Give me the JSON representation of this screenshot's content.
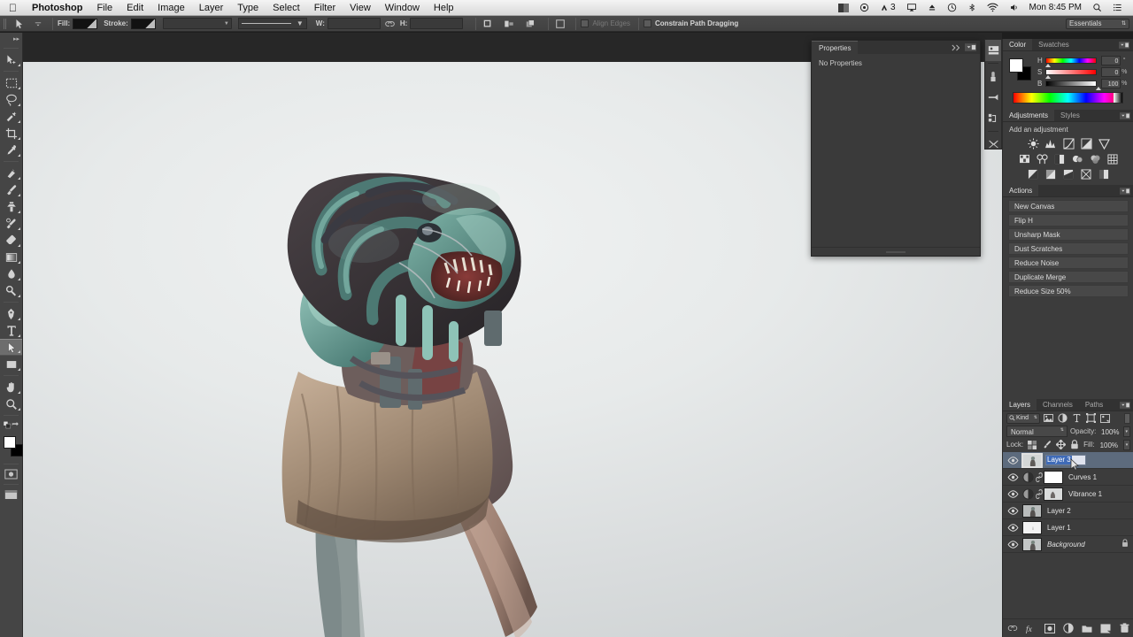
{
  "macos_menubar": {
    "apple_icon": "apple-logo",
    "app_name": "Photoshop",
    "menus": [
      "File",
      "Edit",
      "Image",
      "Layer",
      "Type",
      "Select",
      "Filter",
      "View",
      "Window",
      "Help"
    ],
    "status_items": [
      {
        "name": "display-swatch-icon",
        "label": ""
      },
      {
        "name": "dropbox-icon",
        "label": ""
      },
      {
        "name": "adobe-cc-icon",
        "label": "3"
      },
      {
        "name": "airplay-icon",
        "label": ""
      },
      {
        "name": "eject-icon",
        "label": ""
      },
      {
        "name": "time-machine-icon",
        "label": ""
      },
      {
        "name": "bluetooth-icon",
        "label": ""
      },
      {
        "name": "wifi-icon",
        "label": ""
      },
      {
        "name": "volume-icon",
        "label": ""
      }
    ],
    "clock": "Mon 8:45 PM",
    "spotlight_icon": "search-icon",
    "notification_icon": "list-icon"
  },
  "options_bar": {
    "tool_icon": "path-selection-tool-icon",
    "fill_label": "Fill:",
    "stroke_label": "Stroke:",
    "stroke_width_value": "",
    "stroke_style_value": "",
    "width_label": "W:",
    "width_value": "",
    "link_icon": "link-dimensions-icon",
    "height_label": "H:",
    "height_value": "",
    "path_ops": [
      "path-operations-icon",
      "path-alignment-icon",
      "path-arrangement-icon",
      "path-options-icon"
    ],
    "align_edges_label": "Align Edges",
    "align_edges_checked": false,
    "align_edges_enabled": false,
    "constrain_label": "Constrain Path Dragging",
    "constrain_checked": false
  },
  "workspace": {
    "selector_value": "Essentials"
  },
  "toolbar": {
    "tools": [
      {
        "name": "move-tool",
        "label": "Move Tool",
        "active": false,
        "group": 0
      },
      {
        "name": "rectangular-marquee-tool",
        "label": "Rectangular Marquee Tool",
        "active": false,
        "group": 1
      },
      {
        "name": "lasso-tool",
        "label": "Lasso Tool",
        "active": false,
        "group": 1
      },
      {
        "name": "quick-selection-tool",
        "label": "Quick Selection Tool",
        "active": false,
        "group": 1
      },
      {
        "name": "crop-tool",
        "label": "Crop Tool",
        "active": false,
        "group": 1
      },
      {
        "name": "eyedropper-tool",
        "label": "Eyedropper Tool",
        "active": false,
        "group": 1
      },
      {
        "name": "spot-healing-brush-tool",
        "label": "Spot Healing Brush Tool",
        "active": false,
        "group": 2
      },
      {
        "name": "brush-tool",
        "label": "Brush Tool",
        "active": false,
        "group": 2
      },
      {
        "name": "clone-stamp-tool",
        "label": "Clone Stamp Tool",
        "active": false,
        "group": 2
      },
      {
        "name": "history-brush-tool",
        "label": "History Brush Tool",
        "active": false,
        "group": 2
      },
      {
        "name": "eraser-tool",
        "label": "Eraser Tool",
        "active": false,
        "group": 2
      },
      {
        "name": "gradient-tool",
        "label": "Gradient Tool",
        "active": false,
        "group": 2
      },
      {
        "name": "blur-tool",
        "label": "Blur Tool",
        "active": false,
        "group": 2
      },
      {
        "name": "dodge-tool",
        "label": "Dodge Tool",
        "active": false,
        "group": 2
      },
      {
        "name": "pen-tool",
        "label": "Pen Tool",
        "active": false,
        "group": 3
      },
      {
        "name": "type-tool",
        "label": "Horizontal Type Tool",
        "active": false,
        "group": 3
      },
      {
        "name": "path-selection-tool",
        "label": "Path Selection Tool",
        "active": true,
        "group": 3
      },
      {
        "name": "rectangle-shape-tool",
        "label": "Rectangle Tool",
        "active": false,
        "group": 3
      },
      {
        "name": "hand-tool",
        "label": "Hand Tool",
        "active": false,
        "group": 4
      },
      {
        "name": "zoom-tool",
        "label": "Zoom Tool",
        "active": false,
        "group": 4
      }
    ],
    "foreground_color": "#ffffff",
    "background_color": "#000000",
    "quick_mask_icon": "quick-mask-icon",
    "screen_mode_icon": "screen-mode-icon"
  },
  "properties_panel": {
    "tabs": [
      {
        "label": "Properties",
        "active": true
      }
    ],
    "empty_message": "No Properties"
  },
  "icon_dock": {
    "items": [
      "mini-bridge-icon",
      "brush-presets-icon",
      "brush-settings-icon",
      "clone-source-icon",
      "tool-presets-icon"
    ]
  },
  "color_panel": {
    "tabs": [
      {
        "label": "Color",
        "active": true
      },
      {
        "label": "Swatches",
        "active": false
      }
    ],
    "foreground_color": "#ffffff",
    "background_color": "#000000",
    "sliders": [
      {
        "label": "H",
        "value": "0",
        "unit": "°",
        "knob_pct": 0,
        "track": "hue"
      },
      {
        "label": "S",
        "value": "0",
        "unit": "%",
        "knob_pct": 0,
        "track": "sat"
      },
      {
        "label": "B",
        "value": "100",
        "unit": "%",
        "knob_pct": 100,
        "track": "bri"
      }
    ]
  },
  "adjustments_panel": {
    "tabs": [
      {
        "label": "Adjustments",
        "active": true
      },
      {
        "label": "Styles",
        "active": false
      }
    ],
    "heading": "Add an adjustment",
    "rows": [
      [
        "brightness-contrast-icon",
        "levels-icon",
        "curves-icon",
        "exposure-icon",
        "vibrance-icon"
      ],
      [
        "hue-saturation-icon",
        "color-balance-icon",
        "black-white-icon",
        "photo-filter-icon",
        "channel-mixer-icon",
        "color-lookup-icon"
      ],
      [
        "invert-icon",
        "posterize-icon",
        "threshold-icon",
        "gradient-map-icon",
        "selective-color-icon"
      ]
    ]
  },
  "actions_panel": {
    "tabs": [
      {
        "label": "Actions",
        "active": true
      }
    ],
    "items": [
      "New Canvas",
      "Flip H",
      "Unsharp Mask",
      "Dust Scratches",
      "Reduce Noise",
      "Duplicate Merge",
      "Reduce Size 50%"
    ]
  },
  "layers_panel": {
    "tabs": [
      {
        "label": "Layers",
        "active": true
      },
      {
        "label": "Channels",
        "active": false
      },
      {
        "label": "Paths",
        "active": false
      }
    ],
    "filter": {
      "kind_label": "Kind",
      "search_icon": "search-icon",
      "filter_icons": [
        "filter-pixel-icon",
        "filter-adjustment-icon",
        "filter-type-icon",
        "filter-shape-icon",
        "filter-smart-object-icon"
      ],
      "toggle_icon": "filter-toggle-switch"
    },
    "blend_mode": "Normal",
    "opacity_label": "Opacity:",
    "opacity_value": "100%",
    "fill_label": "Fill:",
    "fill_value": "100%",
    "lock_label": "Lock:",
    "lock_icons": [
      "lock-transparency-icon",
      "lock-image-icon",
      "lock-position-icon",
      "lock-all-icon"
    ],
    "rows": [
      {
        "name": "Layer 3",
        "type": "pixel",
        "visible": true,
        "selected": true,
        "editing": true,
        "locked": false,
        "has_mask": false
      },
      {
        "name": "Curves 1",
        "type": "adjustment-curves",
        "visible": true,
        "selected": false,
        "editing": false,
        "locked": false,
        "has_mask": true
      },
      {
        "name": "Vibrance 1",
        "type": "adjustment-vibrance",
        "visible": true,
        "selected": false,
        "editing": false,
        "locked": false,
        "has_mask": true
      },
      {
        "name": "Layer 2",
        "type": "pixel",
        "visible": true,
        "selected": false,
        "editing": false,
        "locked": false,
        "has_mask": false
      },
      {
        "name": "Layer 1",
        "type": "pixel-empty",
        "visible": true,
        "selected": false,
        "editing": false,
        "locked": false,
        "has_mask": false
      },
      {
        "name": "Background",
        "type": "pixel",
        "visible": true,
        "selected": false,
        "editing": false,
        "locked": true,
        "has_mask": false
      }
    ],
    "footer_icons": [
      "link-layers-icon",
      "layer-style-fx-icon",
      "add-mask-icon",
      "new-adjustment-layer-icon",
      "new-group-icon",
      "new-layer-icon",
      "delete-layer-icon"
    ]
  },
  "canvas": {
    "artwork_title": "creature concept art",
    "background_color": "#e9ecec"
  }
}
